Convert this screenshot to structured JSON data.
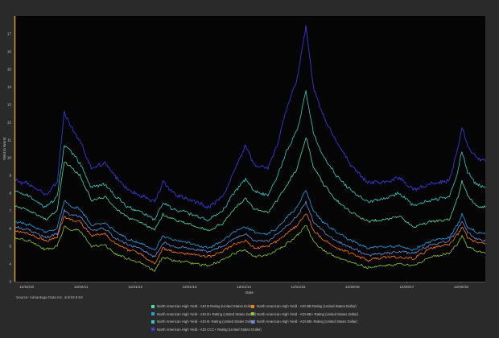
{
  "chart_data": {
    "type": "line",
    "title": "",
    "xlabel": "Date",
    "ylabel": "Yield to Worst",
    "xlim": [
      "2010-10-01",
      "2019-06-01"
    ],
    "ylim": [
      3,
      18
    ],
    "y_ticks": [
      3,
      4,
      5,
      6,
      7,
      8,
      9,
      10,
      11,
      12,
      13,
      14,
      15,
      16,
      17
    ],
    "x_ticks": [
      {
        "label": "12/22/10",
        "date": "2010-12-22"
      },
      {
        "label": "12/22/11",
        "date": "2011-12-22"
      },
      {
        "label": "12/21/12",
        "date": "2012-12-21"
      },
      {
        "label": "12/21/13",
        "date": "2013-12-21"
      },
      {
        "label": "12/21/14",
        "date": "2014-12-21"
      },
      {
        "label": "12/21/15",
        "date": "2015-12-21"
      },
      {
        "label": "12/20/16",
        "date": "2016-12-20"
      },
      {
        "label": "12/20/17",
        "date": "2017-12-20"
      },
      {
        "label": "12/20/18",
        "date": "2018-12-20"
      }
    ],
    "grid": false,
    "legend_position": "bottom",
    "x": [
      "2010-10-01",
      "2011-01-15",
      "2011-05-01",
      "2011-07-15",
      "2011-09-01",
      "2011-10-10",
      "2011-12-15",
      "2012-03-01",
      "2012-06-01",
      "2012-08-01",
      "2012-11-01",
      "2013-01-15",
      "2013-05-01",
      "2013-06-25",
      "2013-09-01",
      "2013-12-01",
      "2014-05-01",
      "2014-08-01",
      "2014-10-15",
      "2015-01-01",
      "2015-03-01",
      "2015-06-01",
      "2015-08-01",
      "2015-10-01",
      "2015-12-15",
      "2016-02-11",
      "2016-04-01",
      "2016-06-01",
      "2016-09-01",
      "2016-12-15",
      "2017-04-01",
      "2017-08-01",
      "2017-11-01",
      "2018-02-01",
      "2018-06-01",
      "2018-10-01",
      "2018-12-01",
      "2018-12-26",
      "2019-02-01",
      "2019-04-01",
      "2019-06-01"
    ],
    "series": [
      {
        "name": "North American High Yield - ADI B Rating (United States Dollar)",
        "color": "#55d8a8",
        "values": [
          7.3,
          7.0,
          6.5,
          7.0,
          9.8,
          9.5,
          9.0,
          7.6,
          7.8,
          7.2,
          6.6,
          6.4,
          5.9,
          6.8,
          6.5,
          6.3,
          5.9,
          6.3,
          7.1,
          7.7,
          7.1,
          6.9,
          7.6,
          8.4,
          9.4,
          11.2,
          9.5,
          8.6,
          7.6,
          6.9,
          6.4,
          6.5,
          6.7,
          6.1,
          6.4,
          6.5,
          7.8,
          8.7,
          7.9,
          7.3,
          7.2
        ]
      },
      {
        "name": "North American High Yield - ADI BB Rating (United States Dollar)",
        "color": "#ff7a1a",
        "values": [
          5.9,
          5.7,
          5.3,
          5.5,
          6.7,
          6.5,
          6.4,
          5.6,
          5.7,
          5.2,
          4.8,
          4.6,
          4.0,
          4.9,
          4.7,
          4.6,
          4.4,
          4.7,
          5.1,
          5.3,
          4.9,
          5.0,
          5.3,
          5.7,
          6.2,
          6.9,
          5.9,
          5.4,
          4.9,
          4.6,
          4.2,
          4.4,
          4.4,
          4.3,
          4.9,
          5.1,
          5.7,
          6.1,
          5.5,
          5.2,
          5.1
        ]
      },
      {
        "name": "North American High Yield - ADI B+ Rating (United States Dollar)",
        "color": "#2a9fe0",
        "values": [
          6.4,
          6.2,
          5.8,
          6.0,
          7.6,
          7.3,
          7.1,
          6.2,
          6.3,
          5.9,
          5.4,
          5.2,
          4.8,
          5.6,
          5.4,
          5.2,
          4.9,
          5.3,
          5.8,
          6.1,
          5.8,
          5.7,
          6.0,
          6.6,
          7.2,
          8.2,
          7.0,
          6.4,
          5.8,
          5.3,
          4.9,
          5.0,
          5.0,
          4.8,
          5.3,
          5.5,
          6.3,
          6.8,
          6.1,
          5.8,
          5.7
        ]
      },
      {
        "name": "North American High Yield - ADI BB+ Rating (United States Dollar)",
        "color": "#8ac83a",
        "values": [
          5.5,
          5.3,
          4.8,
          5.0,
          6.1,
          5.9,
          5.9,
          5.0,
          5.1,
          4.6,
          4.3,
          4.1,
          3.6,
          4.4,
          4.2,
          4.1,
          3.9,
          4.2,
          4.6,
          4.8,
          4.4,
          4.5,
          4.8,
          5.1,
          5.6,
          6.2,
          5.3,
          4.8,
          4.4,
          4.1,
          3.8,
          3.9,
          4.0,
          3.9,
          4.4,
          4.6,
          5.2,
          5.6,
          5.0,
          4.7,
          4.6
        ]
      },
      {
        "name": "North American High Yield - ADI B- Rating (United States Dollar)",
        "color": "#37c9c4",
        "values": [
          8.1,
          7.8,
          7.2,
          7.8,
          10.7,
          10.4,
          9.7,
          8.3,
          8.5,
          7.9,
          7.2,
          7.0,
          6.5,
          7.5,
          7.1,
          6.9,
          6.5,
          7.0,
          8.0,
          8.8,
          8.1,
          7.9,
          8.9,
          10.3,
          11.6,
          13.7,
          11.4,
          10.2,
          9.0,
          8.1,
          7.5,
          7.7,
          8.0,
          7.3,
          7.6,
          7.8,
          9.3,
          10.4,
          9.2,
          8.5,
          8.3
        ]
      },
      {
        "name": "North American High Yield - ADI BB- Rating (United States Dollar)",
        "color": "#6a8fd8",
        "values": [
          6.1,
          5.9,
          5.5,
          5.7,
          7.0,
          6.8,
          6.7,
          5.9,
          6.0,
          5.5,
          5.1,
          4.9,
          4.4,
          5.2,
          5.0,
          4.9,
          4.7,
          5.0,
          5.4,
          5.7,
          5.3,
          5.3,
          5.7,
          6.1,
          6.7,
          7.5,
          6.4,
          5.9,
          5.3,
          4.9,
          4.5,
          4.6,
          4.7,
          4.6,
          5.1,
          5.3,
          6.0,
          6.4,
          5.8,
          5.4,
          5.3
        ]
      },
      {
        "name": "North American High Yield - ADI CCC+ Rating (United States Dollar)",
        "color": "#3f3fe6",
        "values": [
          8.7,
          8.5,
          7.9,
          8.6,
          12.6,
          11.8,
          11.0,
          9.4,
          9.7,
          9.0,
          8.2,
          7.9,
          7.5,
          8.6,
          8.0,
          7.7,
          7.2,
          7.8,
          9.2,
          10.7,
          9.6,
          9.4,
          10.7,
          12.7,
          14.5,
          17.4,
          14.0,
          12.5,
          10.9,
          9.5,
          8.6,
          8.6,
          8.9,
          8.2,
          8.5,
          8.7,
          10.6,
          11.8,
          10.7,
          10.0,
          9.8
        ]
      }
    ]
  },
  "legend": {
    "rows": [
      [
        0,
        1
      ],
      [
        2,
        3
      ],
      [
        4,
        5
      ],
      [
        6
      ]
    ]
  },
  "source_note": "Source: Advantage Data Inc. 4/4/19 9:04"
}
